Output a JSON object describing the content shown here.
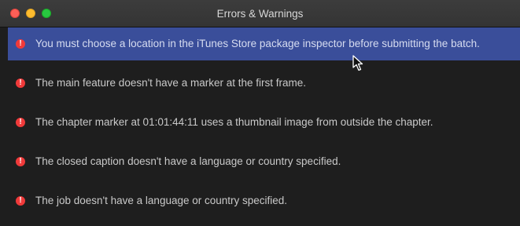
{
  "window": {
    "title": "Errors & Warnings"
  },
  "colors": {
    "selection": "#3a4e9a",
    "error": "#f03a3a",
    "background": "#1e1e1e"
  },
  "issues": [
    {
      "icon": "error-icon",
      "message": "You must choose a location in the iTunes Store package inspector before submitting the batch.",
      "selected": true
    },
    {
      "icon": "error-icon",
      "message": "The main feature doesn't have a marker at the first frame.",
      "selected": false
    },
    {
      "icon": "error-icon",
      "message": "The chapter marker at 01:01:44:11 uses a thumbnail image from outside the chapter.",
      "selected": false
    },
    {
      "icon": "error-icon",
      "message": "The closed caption doesn't have a language or country specified.",
      "selected": false
    },
    {
      "icon": "error-icon",
      "message": "The job doesn't have a language or country specified.",
      "selected": false
    }
  ]
}
